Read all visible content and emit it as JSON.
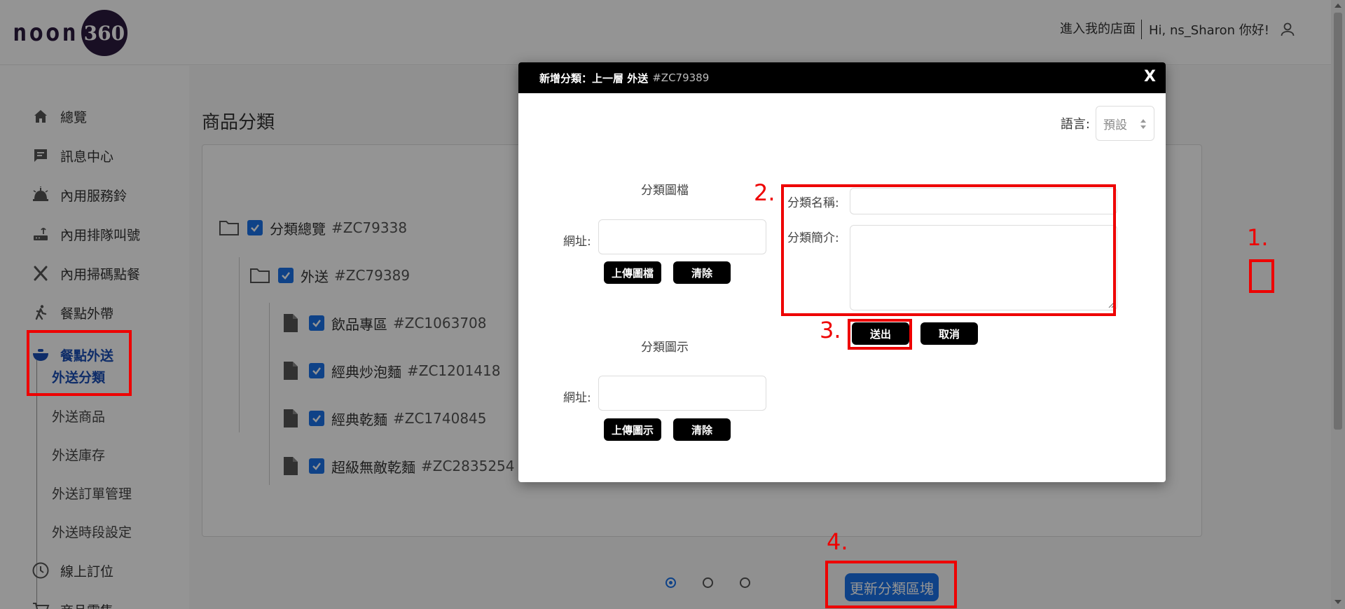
{
  "header": {
    "logo_text": "noon",
    "logo_badge": "360",
    "store_link": "進入我的店面",
    "greeting": "Hi, ns_Sharon 你好!"
  },
  "sidebar": {
    "items": [
      {
        "label": "總覽",
        "icon": "home-icon"
      },
      {
        "label": "訊息中心",
        "icon": "message-icon"
      },
      {
        "label": "內用服務鈴",
        "icon": "bell-icon"
      },
      {
        "label": "內用排隊叫號",
        "icon": "router-icon"
      },
      {
        "label": "內用掃碼點餐",
        "icon": "utensils-icon"
      },
      {
        "label": "餐點外帶",
        "icon": "walking-icon"
      },
      {
        "label": "餐點外送",
        "icon": "bowl-icon"
      },
      {
        "label": "線上訂位",
        "icon": "clock-icon"
      },
      {
        "label": "商品零售",
        "icon": "cart-icon"
      }
    ],
    "sub_items": [
      "外送分類",
      "外送商品",
      "外送庫存",
      "外送訂單管理",
      "外送時段設定"
    ]
  },
  "main": {
    "page_title": "商品分類",
    "tree": [
      {
        "label": "分類總覽",
        "code": "#ZC79338"
      },
      {
        "label": "外送",
        "code": "#ZC79389"
      },
      {
        "label": "飲品專區",
        "code": "#ZC1063708"
      },
      {
        "label": "經典炒泡麵",
        "code": "#ZC1201418"
      },
      {
        "label": "經典乾麵",
        "code": "#ZC1740845"
      },
      {
        "label": "超級無敵乾麵",
        "code": "#ZC2835254"
      }
    ],
    "update_button": "更新分類區塊",
    "pager": {
      "pages": 3,
      "current": 1
    }
  },
  "modal": {
    "title": "新增分類：上一層 外送",
    "title_code": "#ZC79389",
    "close": "X",
    "language_label": "語言:",
    "language_value": "預設",
    "image_section": "分類圖檔",
    "icon_section": "分類圖示",
    "url_label": "網址:",
    "upload_image": "上傳圖檔",
    "upload_icon": "上傳圖示",
    "clear": "清除",
    "name_label": "分類名稱:",
    "desc_label": "分類簡介:",
    "submit": "送出",
    "cancel": "取消"
  },
  "annotations": [
    "1.",
    "2.",
    "3.",
    "4."
  ],
  "colors": {
    "accent": "#1a73e8",
    "annotation": "#e00000",
    "modal_header": "#000000"
  }
}
